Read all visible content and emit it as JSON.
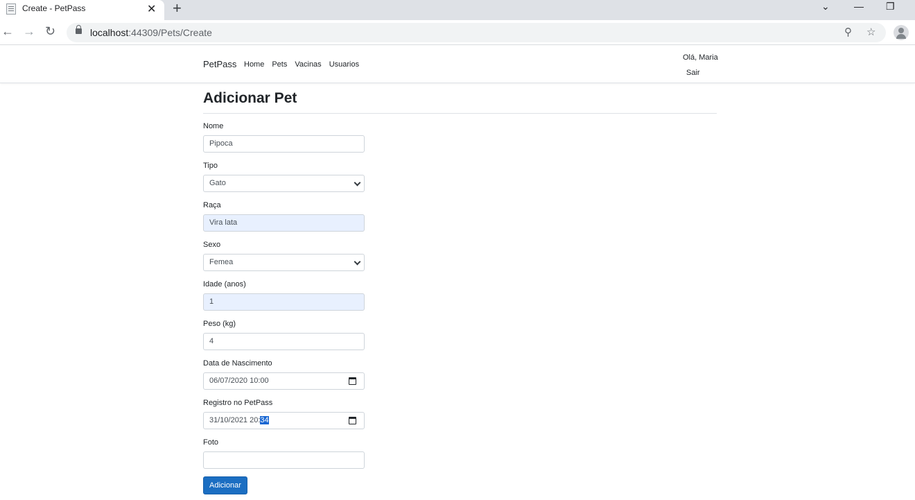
{
  "browser": {
    "tab_title": "Create - PetPass",
    "url_host": "localhost",
    "url_path": ":44309/Pets/Create"
  },
  "navbar": {
    "brand": "PetPass",
    "links": [
      "Home",
      "Pets",
      "Vacinas",
      "Usuarios"
    ],
    "greeting": "Olá, Maria",
    "logout": "Sair"
  },
  "form": {
    "title": "Adicionar Pet",
    "nome": {
      "label": "Nome",
      "value": "Pipoca"
    },
    "tipo": {
      "label": "Tipo",
      "value": "Gato"
    },
    "raca": {
      "label": "Raça",
      "value": "Vira lata"
    },
    "sexo": {
      "label": "Sexo",
      "value": "Femea"
    },
    "idade": {
      "label": "Idade (anos)",
      "value": "1"
    },
    "peso": {
      "label": "Peso (kg)",
      "value": "4"
    },
    "nascimento": {
      "label": "Data de Nascimento",
      "value": "06/07/2020 10:00"
    },
    "registro": {
      "label": "Registro no PetPass",
      "value_prefix": "31/10/2021 20:",
      "value_selected": "34"
    },
    "foto": {
      "label": "Foto",
      "value": ""
    },
    "submit": "Adicionar"
  }
}
